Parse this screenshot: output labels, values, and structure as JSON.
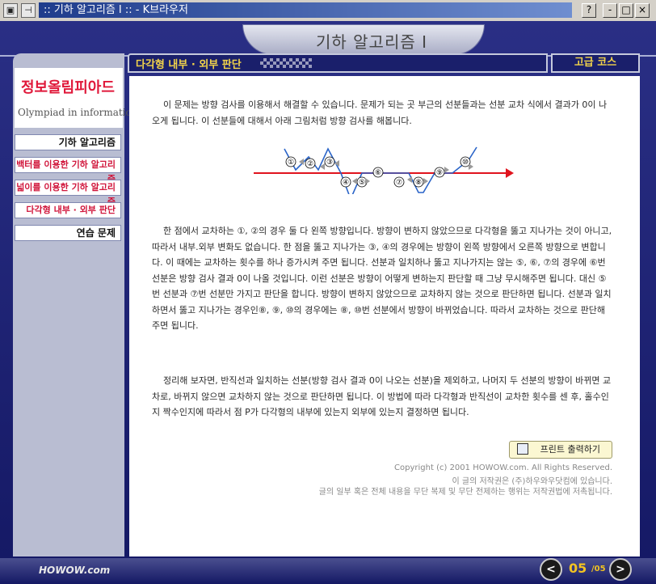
{
  "window": {
    "title": ":: 기하 알고리즘 I :: - K브라우저",
    "buttons": {
      "help": "?",
      "minimize": "-",
      "maximize": "□",
      "close": "×"
    }
  },
  "header": {
    "title": "기하 알고리즘 I"
  },
  "sidebar": {
    "logo_korean": "정보올림피아드",
    "logo_english": "Olympiad in informatics",
    "items": [
      {
        "label": "기하 알고리즘"
      },
      {
        "label": "백터를 이용한 기하 알고리즘"
      },
      {
        "label": "넓이를 이용한 기하 알고리즘"
      },
      {
        "label": "다각형 내부 · 외부 판단"
      },
      {
        "label": "연습 문제"
      }
    ]
  },
  "content": {
    "section_title": "다각형 내부 · 외부 판단",
    "level": "고급 코스",
    "paragraphs": [
      "이 문제는 방향 검사를 이용해서 해결할 수 있습니다. 문제가 되는 곳 부근의 선분들과는 선분 교차 식에서 결과가 0이 나오게 됩니다. 이 선분들에 대해서 아래 그림처럼 방향 검사를 해봅니다.",
      "한 점에서 교차하는 ①, ②의 경우 둘 다 왼쪽 방향입니다. 방향이 변하지 않았으므로 다각형을 뚫고 지나가는 것이 아니고, 따라서 내부.외부 변화도 없습니다. 한 점을 뚫고 지나가는 ③, ④의 경우에는 방향이 왼쪽 방향에서 오른쪽 방향으로 변합니다. 이 때에는 교차하는 횟수를 하나 증가시켜 주면 됩니다. 선분과 일치하나 뚫고 지나가지는 않는 ⑤, ⑥, ⑦의 경우에 ⑥번 선분은 방향 검사 결과 0이 나올 것입니다. 이런 선분은 방향이 어떻게 변하는지 판단할 때 그냥 무시해주면 됩니다. 대신 ⑤번 선분과 ⑦번 선분만 가지고 판단을 합니다. 방향이 변하지 않았으므로 교차하지 않는 것으로 판단하면 됩니다. 선분과 일치하면서 뚫고 지나가는 경우인⑧, ⑨, ⑩의 경우에는 ⑧, ⑩번 선분에서 방향이 바뀌었습니다. 따라서 교차하는 것으로 판단해 주면 됩니다.",
      "정리해 보자면, 반직선과 일치하는 선분(방향 검사 결과 0이 나오는 선분)을 제외하고, 나머지 두 선분의 방향이 바뀌면 교차로, 바뀌지 않으면 교차하지 않는 것으로 판단하면 됩니다. 이 방법에 따라 다각형과 반직선이 교차한 횟수를 센 후, 홀수인지 짝수인지에 따라서 점 P가 다각형의 내부에 있는지 외부에 있는지 결정하면 됩니다."
    ],
    "diagram_labels": [
      "①",
      "②",
      "③",
      "④",
      "⑤",
      "⑥",
      "⑦",
      "⑧",
      "⑨",
      "⑩"
    ],
    "print_button": "프린트 출력하기",
    "copyright": [
      "Copyright (c) 2001 HOWOW.com. All Rights Reserved.",
      "이 글의 저작권은 (주)하우와우닷컴에 있습니다.",
      "글의 일부 혹은 전체 내용을 무단 복제 및 무단 전제하는 행위는 저작권법에 저촉됩니다."
    ]
  },
  "footer": {
    "brand": "HOWOW.com",
    "page_current": "05",
    "page_total": "/05",
    "prev": "<",
    "next": ">"
  }
}
